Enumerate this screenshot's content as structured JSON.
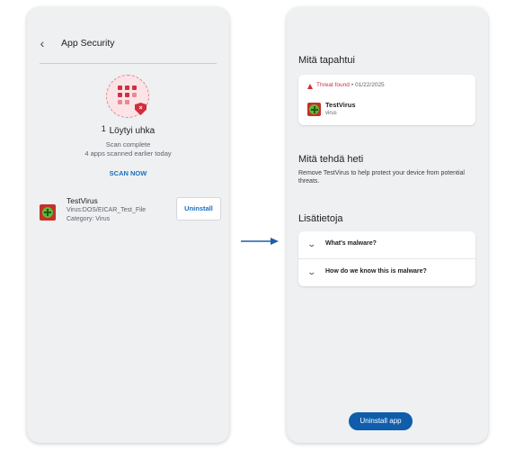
{
  "left": {
    "app_title": "App Security",
    "threat_count": "1",
    "threat_title": "Löytyi uhka",
    "scan_status": "Scan complete",
    "scan_detail": "4 apps scanned earlier today",
    "scan_now": "SCAN NOW",
    "app": {
      "name": "TestVirus",
      "detail": "Virus:DOS/EICAR_Test_File",
      "category": "Category: Virus",
      "action": "Uninstall"
    }
  },
  "right": {
    "what_happened": "Mitä tapahtui",
    "event": {
      "status": "Threat found",
      "separator": "•",
      "date": "01/22/2025",
      "name": "TestVirus",
      "type": "virus"
    },
    "what_to_do": "Mitä tehdä heti",
    "what_to_do_text": "Remove TestVirus to help protect your device from potential threats.",
    "more_info": "Lisätietoja",
    "faq": [
      "What's malware?",
      "How do we know this is malware?"
    ],
    "primary_action": "Uninstall app"
  },
  "colors": {
    "accent": "#1a6fc0",
    "primary_button": "#0f5dab",
    "threat": "#d0303f",
    "background": "#eef0f2"
  },
  "icons": [
    "back-arrow-icon",
    "app-grid-icon",
    "shield-x-icon",
    "virus-app-icon",
    "warning-icon",
    "chevron-down-icon",
    "arrow-right-icon"
  ]
}
